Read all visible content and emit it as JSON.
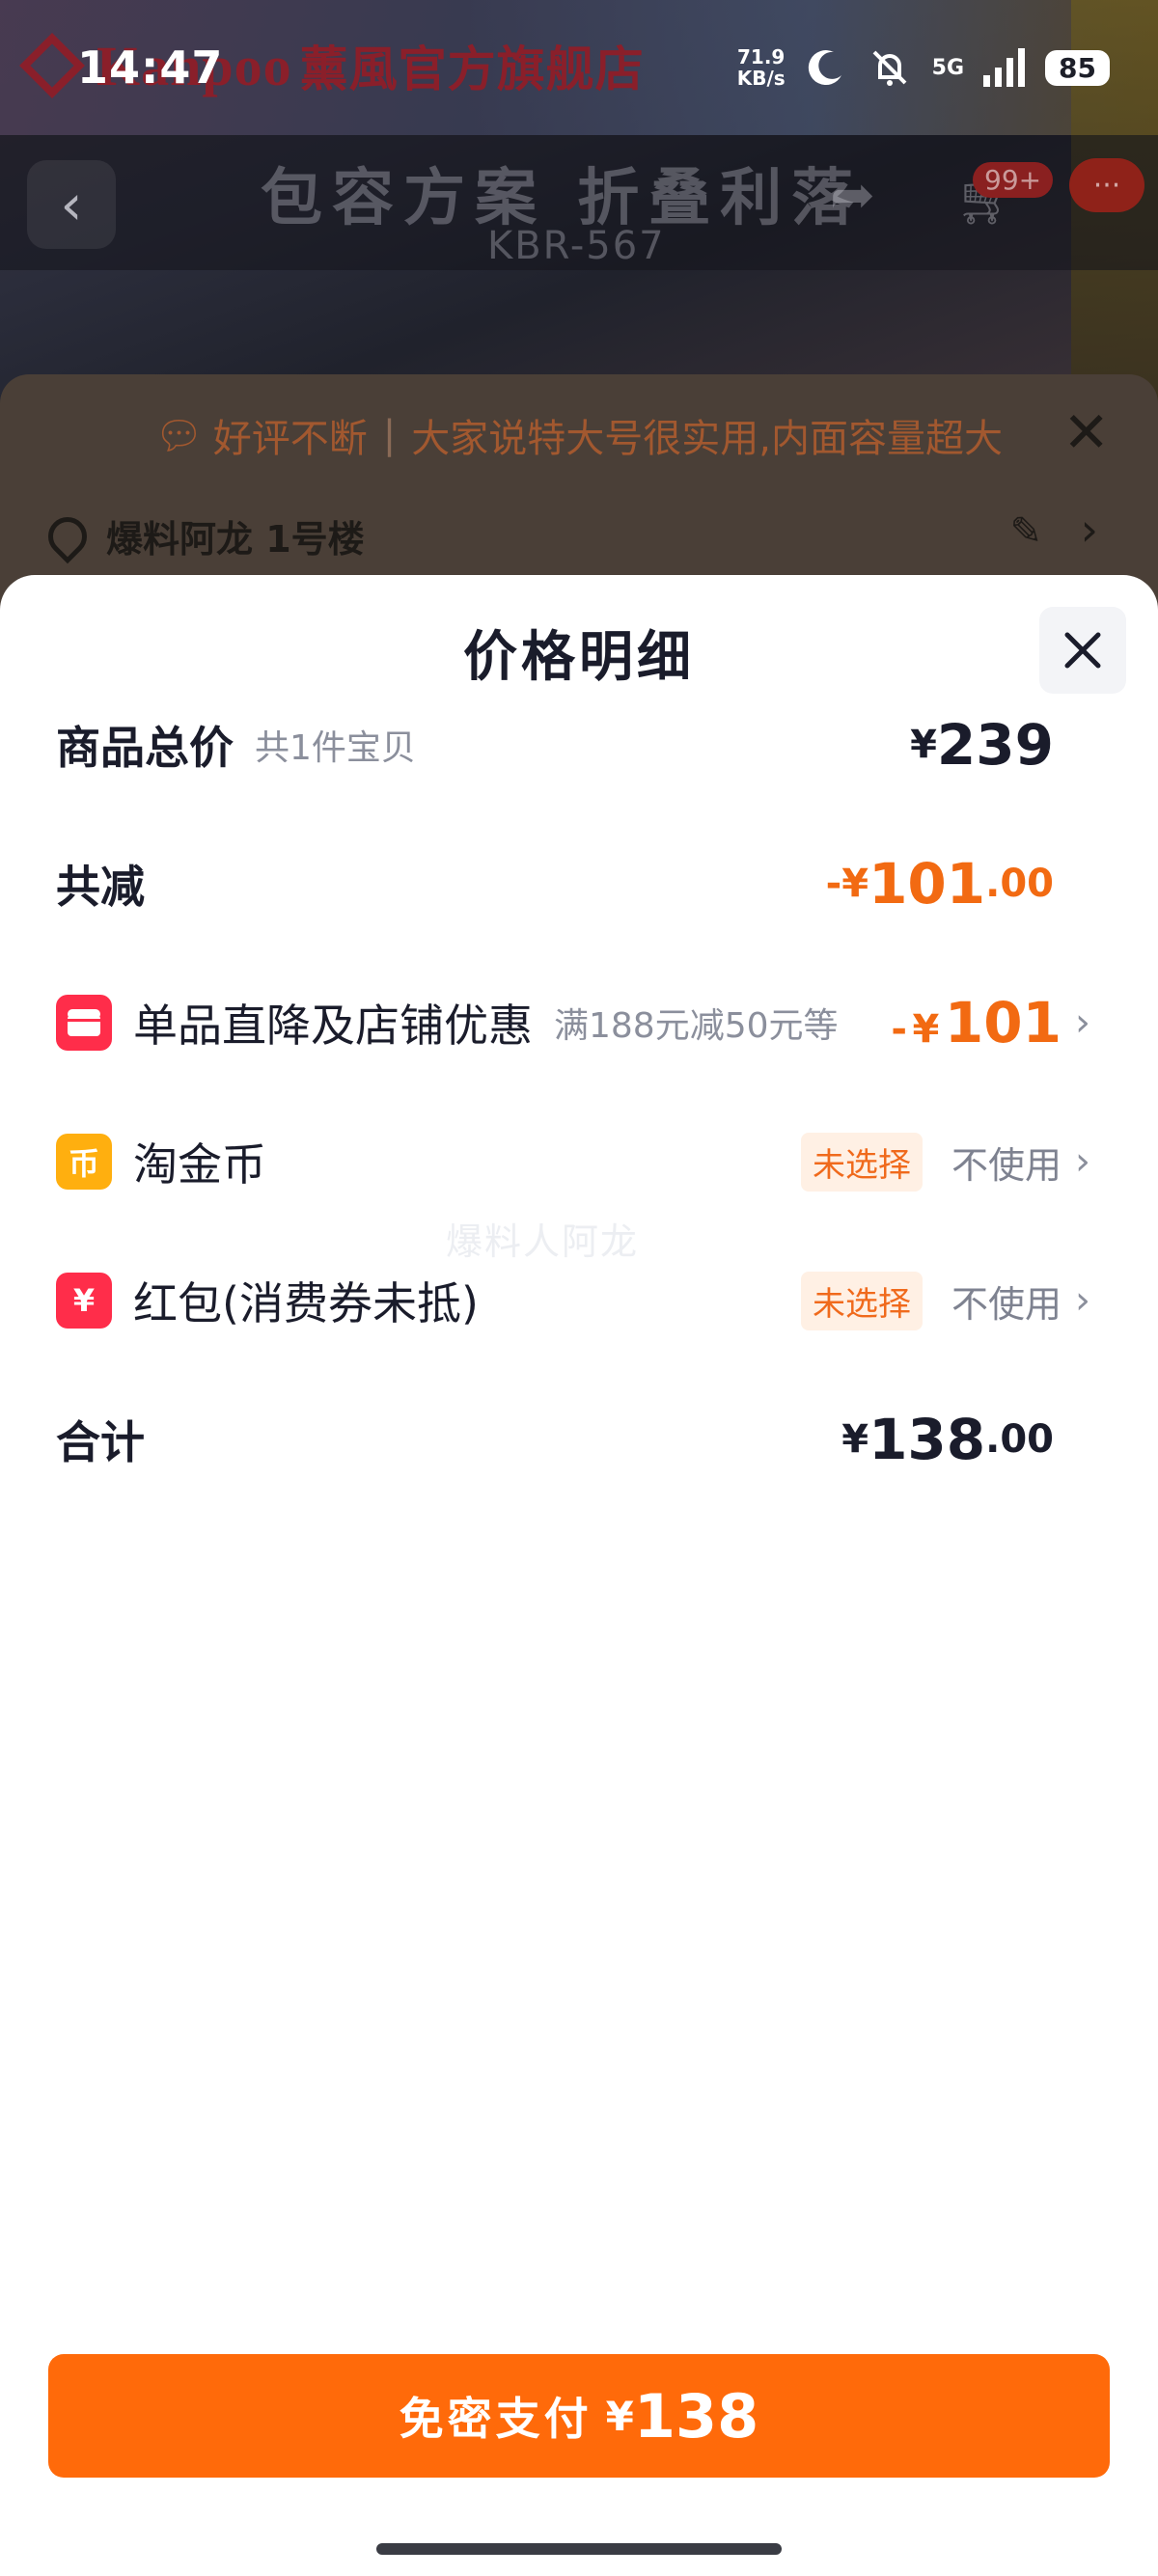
{
  "status_bar": {
    "time": "14:47",
    "net_speed_value": "71.9",
    "net_speed_unit": "KB/s",
    "network": "5G",
    "battery": "85"
  },
  "background_page": {
    "brand_logo_text": "Kanpoo",
    "store_name": "薰風官方旗舰店",
    "hero_title": "包容方案 折叠利落",
    "hero_model": "KBR-567",
    "cart_badge": "99+",
    "msg_badge": "···",
    "review_banner": {
      "label": "好评不断",
      "text": "大家说特大号很实用,内面容量超大"
    },
    "address": "爆料阿龙 1号楼"
  },
  "sheet": {
    "title": "价格明细",
    "rows": {
      "total": {
        "label": "商品总价",
        "note": "共1件宝贝",
        "currency": "¥",
        "amount": "239"
      },
      "discount_sum": {
        "label": "共减",
        "sign": "-",
        "currency": "¥",
        "amount": "101",
        "decimals": ".00"
      },
      "store_discount": {
        "label": "单品直降及店铺优惠",
        "note": "满188元减50元等",
        "sign": "-",
        "currency": "¥",
        "amount": "101"
      },
      "tao_coin": {
        "label": "淘金币",
        "badge": "未选择",
        "action": "不使用"
      },
      "red_packet": {
        "label": "红包(消费券未抵)",
        "badge": "未选择",
        "action": "不使用"
      },
      "grand_total": {
        "label": "合计",
        "currency": "¥",
        "amount": "138",
        "decimals": ".00"
      }
    },
    "watermark": "爆料人阿龙"
  },
  "pay_button": {
    "label": "免密支付",
    "currency": "¥",
    "amount": "138"
  },
  "colors": {
    "accent_orange": "#ff6a0a",
    "discount_orange": "#f26a12",
    "icon_red": "#ff2d4a",
    "icon_gold": "#ffaf0f"
  }
}
